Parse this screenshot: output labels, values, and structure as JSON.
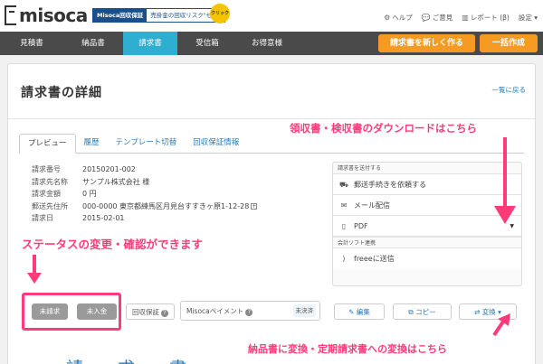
{
  "brand": {
    "logo_text": "misoca",
    "promo_tag": "Misoca回収保証",
    "promo_text": "売掛金の回収リスク\"ゼロ\"",
    "promo_badge": "クリック"
  },
  "toplinks": [
    {
      "label": "ヘルプ",
      "icon": "gear-icon"
    },
    {
      "label": "ご意見",
      "icon": "chat-icon"
    },
    {
      "label": "レポート (β)",
      "icon": "chart-icon"
    },
    {
      "label": "設定 ▾",
      "icon": "none"
    }
  ],
  "nav": {
    "items": [
      "見積書",
      "納品書",
      "請求書",
      "受信箱",
      "お得意様"
    ],
    "active": "請求書",
    "new_invoice": "請求書を新しく作る",
    "bulk_create": "一括作成"
  },
  "page": {
    "title": "請求書の詳細",
    "back_link": "一覧に戻る"
  },
  "tabs": [
    "プレビュー",
    "履歴",
    "テンプレート切替",
    "回収保証情報"
  ],
  "info": [
    {
      "label": "請求番号",
      "value": "20150201-002"
    },
    {
      "label": "請求先名称",
      "value": "サンプル株式会社 様"
    },
    {
      "label": "請求金額",
      "value": "0 円"
    },
    {
      "label": "郵送先住所",
      "value": "000-0000 東京都練馬区月見台すすきヶ原1-12-28"
    },
    {
      "label": "請求日",
      "value": "2015-02-01"
    }
  ],
  "send": {
    "heading": "請求書を送付する",
    "mail_request": "郵送手続きを依頼する",
    "email": "メール配信",
    "pdf": "PDF",
    "accounting_heading": "会計ソフト連携",
    "freee": "freeeに送信"
  },
  "toolbar": {
    "unbilled": "未請求",
    "unpaid": "未入金",
    "guarantee": "回収保証",
    "payment": "Misocaペイメント",
    "payment_status": "未決済",
    "edit": "編集",
    "copy": "コピー",
    "convert": "変換"
  },
  "preview_heading": "請 求 書",
  "annotations": {
    "receipt": "領収書・検収書のダウンロードはこちら",
    "status": "ステータスの変更・確認ができます",
    "convert": "納品書に変換・定期請求書への変換はこちら"
  },
  "colors": {
    "accent": "#2eaed1",
    "orange": "#f59b23",
    "annotation": "#ff3b7a",
    "nav": "#4a4a4a"
  }
}
